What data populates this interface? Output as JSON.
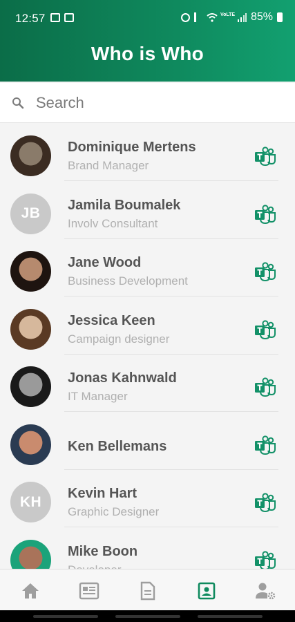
{
  "status_bar": {
    "time": "12:57",
    "battery": "85%"
  },
  "header": {
    "title": "Who is Who"
  },
  "search": {
    "placeholder": "Search"
  },
  "contacts": [
    {
      "name": "Dominique Mertens",
      "role": "Brand Manager",
      "avatar": "photo",
      "photo_colors": [
        "#8a7b6a",
        "#3b2c22"
      ]
    },
    {
      "name": "Jamila Boumalek",
      "role": "Involv Consultant",
      "avatar": "initials",
      "initials": "JB"
    },
    {
      "name": "Jane Wood",
      "role": "Business Development",
      "avatar": "photo",
      "photo_colors": [
        "#b68a6e",
        "#1e1410"
      ]
    },
    {
      "name": "Jessica Keen",
      "role": "Campaign designer",
      "avatar": "photo",
      "photo_colors": [
        "#d6b89c",
        "#5a3a24"
      ]
    },
    {
      "name": "Jonas Kahnwald",
      "role": "IT Manager",
      "avatar": "photo",
      "photo_colors": [
        "#9a9a9a",
        "#1a1a1a"
      ]
    },
    {
      "name": "Ken Bellemans",
      "role": "",
      "avatar": "photo",
      "photo_colors": [
        "#c98b6e",
        "#2a3b52"
      ]
    },
    {
      "name": "Kevin Hart",
      "role": "Graphic Designer",
      "avatar": "initials",
      "initials": "KH"
    },
    {
      "name": "Mike Boon",
      "role": "Developer",
      "avatar": "photo",
      "photo_colors": [
        "#a9735a",
        "#1ba37a"
      ]
    }
  ],
  "icons": {
    "contact_action": "microsoft-teams-icon",
    "search": "search-icon"
  },
  "bottom_nav": [
    {
      "name": "home-icon",
      "active": false
    },
    {
      "name": "news-icon",
      "active": false
    },
    {
      "name": "document-icon",
      "active": false
    },
    {
      "name": "contacts-icon",
      "active": true
    },
    {
      "name": "user-settings-icon",
      "active": false
    }
  ],
  "colors": {
    "brand_green": "#0f8a5e",
    "teams_green": "#139168",
    "nav_inactive": "#9e9e9e",
    "nav_active": "#0f8a5e"
  }
}
